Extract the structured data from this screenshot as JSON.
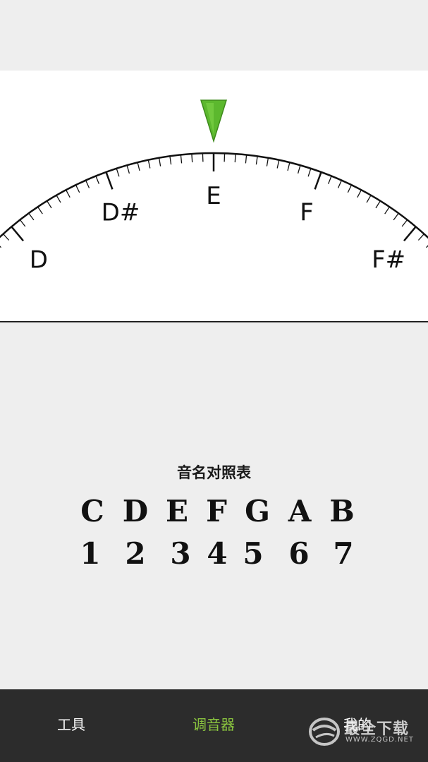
{
  "tuner": {
    "notes": [
      {
        "label": "D",
        "cents": -200
      },
      {
        "label": "D#",
        "cents": -100
      },
      {
        "label": "E",
        "cents": 0
      },
      {
        "label": "F",
        "cents": 100
      },
      {
        "label": "F#",
        "cents": 200
      }
    ],
    "indicator_color": "#5cb82e"
  },
  "note_chart": {
    "title": "音名对照表",
    "letters": [
      "C",
      "D",
      "E",
      "F",
      "G",
      "A",
      "B"
    ],
    "numbers": [
      "1",
      "2",
      "3",
      "4",
      "5",
      "6",
      "7"
    ]
  },
  "nav": {
    "tools_label": "工具",
    "tuner_label": "调音器",
    "mine_label": "我的",
    "active_color": "#8ac43f"
  },
  "watermark": {
    "text": "最全下载",
    "sub": "WWW.ZQGD.NET"
  }
}
